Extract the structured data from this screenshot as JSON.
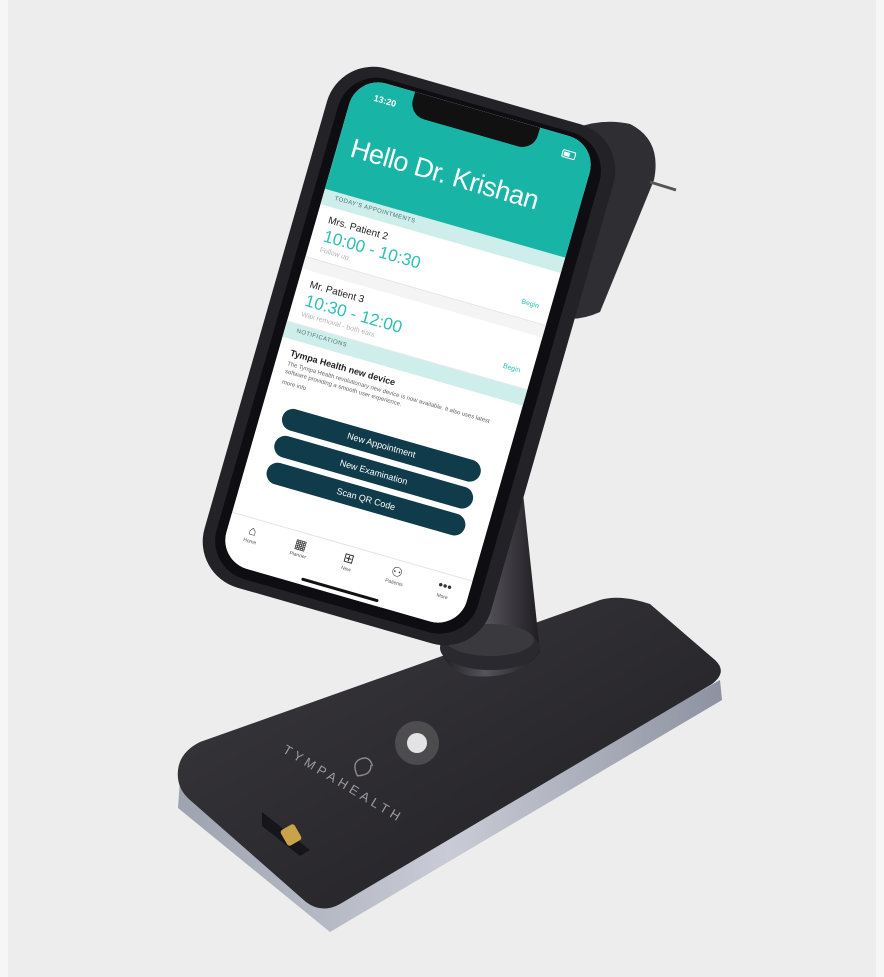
{
  "status": {
    "time": "13:20"
  },
  "greeting": "Hello Dr. Krishan",
  "sections": {
    "appointments": "TODAY'S APPOINTMENTS",
    "notifications": "NOTIFICATIONS"
  },
  "appointments": [
    {
      "name": "Mrs. Patient 2",
      "time": "10:00 - 10:30",
      "note": "Follow up",
      "action": "Begin"
    },
    {
      "name": "Mr. Patient 3",
      "time": "10:30 - 12:00",
      "note": "Wax removal - both ears",
      "action": "Begin"
    }
  ],
  "notification": {
    "title": "Tympa Health new device",
    "body": "The Tympa Health revolutionary new device is now available. It also uses latest software providing a smooth user experience.",
    "more": "more info"
  },
  "buttons": {
    "new_appointment": "New Appointment",
    "new_examination": "New Examination",
    "scan_qr": "Scan QR Code"
  },
  "tabs": [
    {
      "label": "Home",
      "icon": "home-icon"
    },
    {
      "label": "Planner",
      "icon": "calendar-icon"
    },
    {
      "label": "New",
      "icon": "plus-icon"
    },
    {
      "label": "Patients",
      "icon": "people-icon"
    },
    {
      "label": "More",
      "icon": "more-icon"
    }
  ],
  "brand": {
    "logo_text": "TYMPAHEALTH"
  },
  "colors": {
    "teal": "#18b5a7",
    "navy_button": "#0f3b4a",
    "background": "#ededed",
    "device_dark": "#2b2a2e"
  }
}
